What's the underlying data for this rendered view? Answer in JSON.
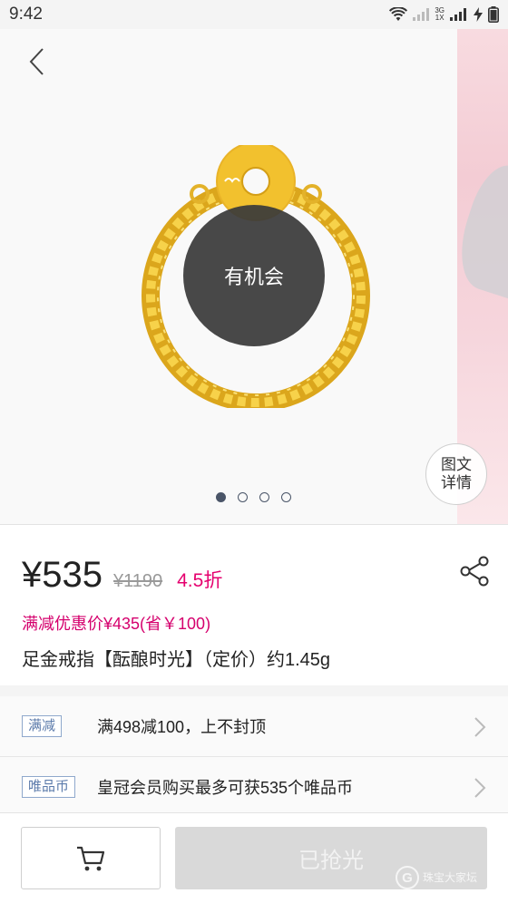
{
  "status_bar": {
    "time": "9:42",
    "network_label_top": "3G",
    "network_label_bottom": "1X"
  },
  "gallery": {
    "overlay_text": "有机会",
    "detail_button_line1": "图文",
    "detail_button_line2": "详情",
    "page_count": 4,
    "active_page": 1
  },
  "product": {
    "price": "¥535",
    "original_price": "¥1190",
    "discount": "4.5折",
    "promo_price": "满减优惠价¥435(省￥100)",
    "title": "足金戒指【酝酿时光】（定价）约1.45g"
  },
  "promotions": [
    {
      "tag": "满减",
      "text": "满498减100，上不封顶"
    },
    {
      "tag": "唯品币",
      "text": "皇冠会员购买最多可获535个唯品币"
    }
  ],
  "bottom_bar": {
    "soldout_label": "已抢光"
  },
  "watermark": {
    "logo": "G",
    "text": "珠宝大家坛"
  },
  "colors": {
    "accent_pink": "#e5006e",
    "tag_blue": "#5c7bab",
    "gold": "#f2c12e"
  }
}
